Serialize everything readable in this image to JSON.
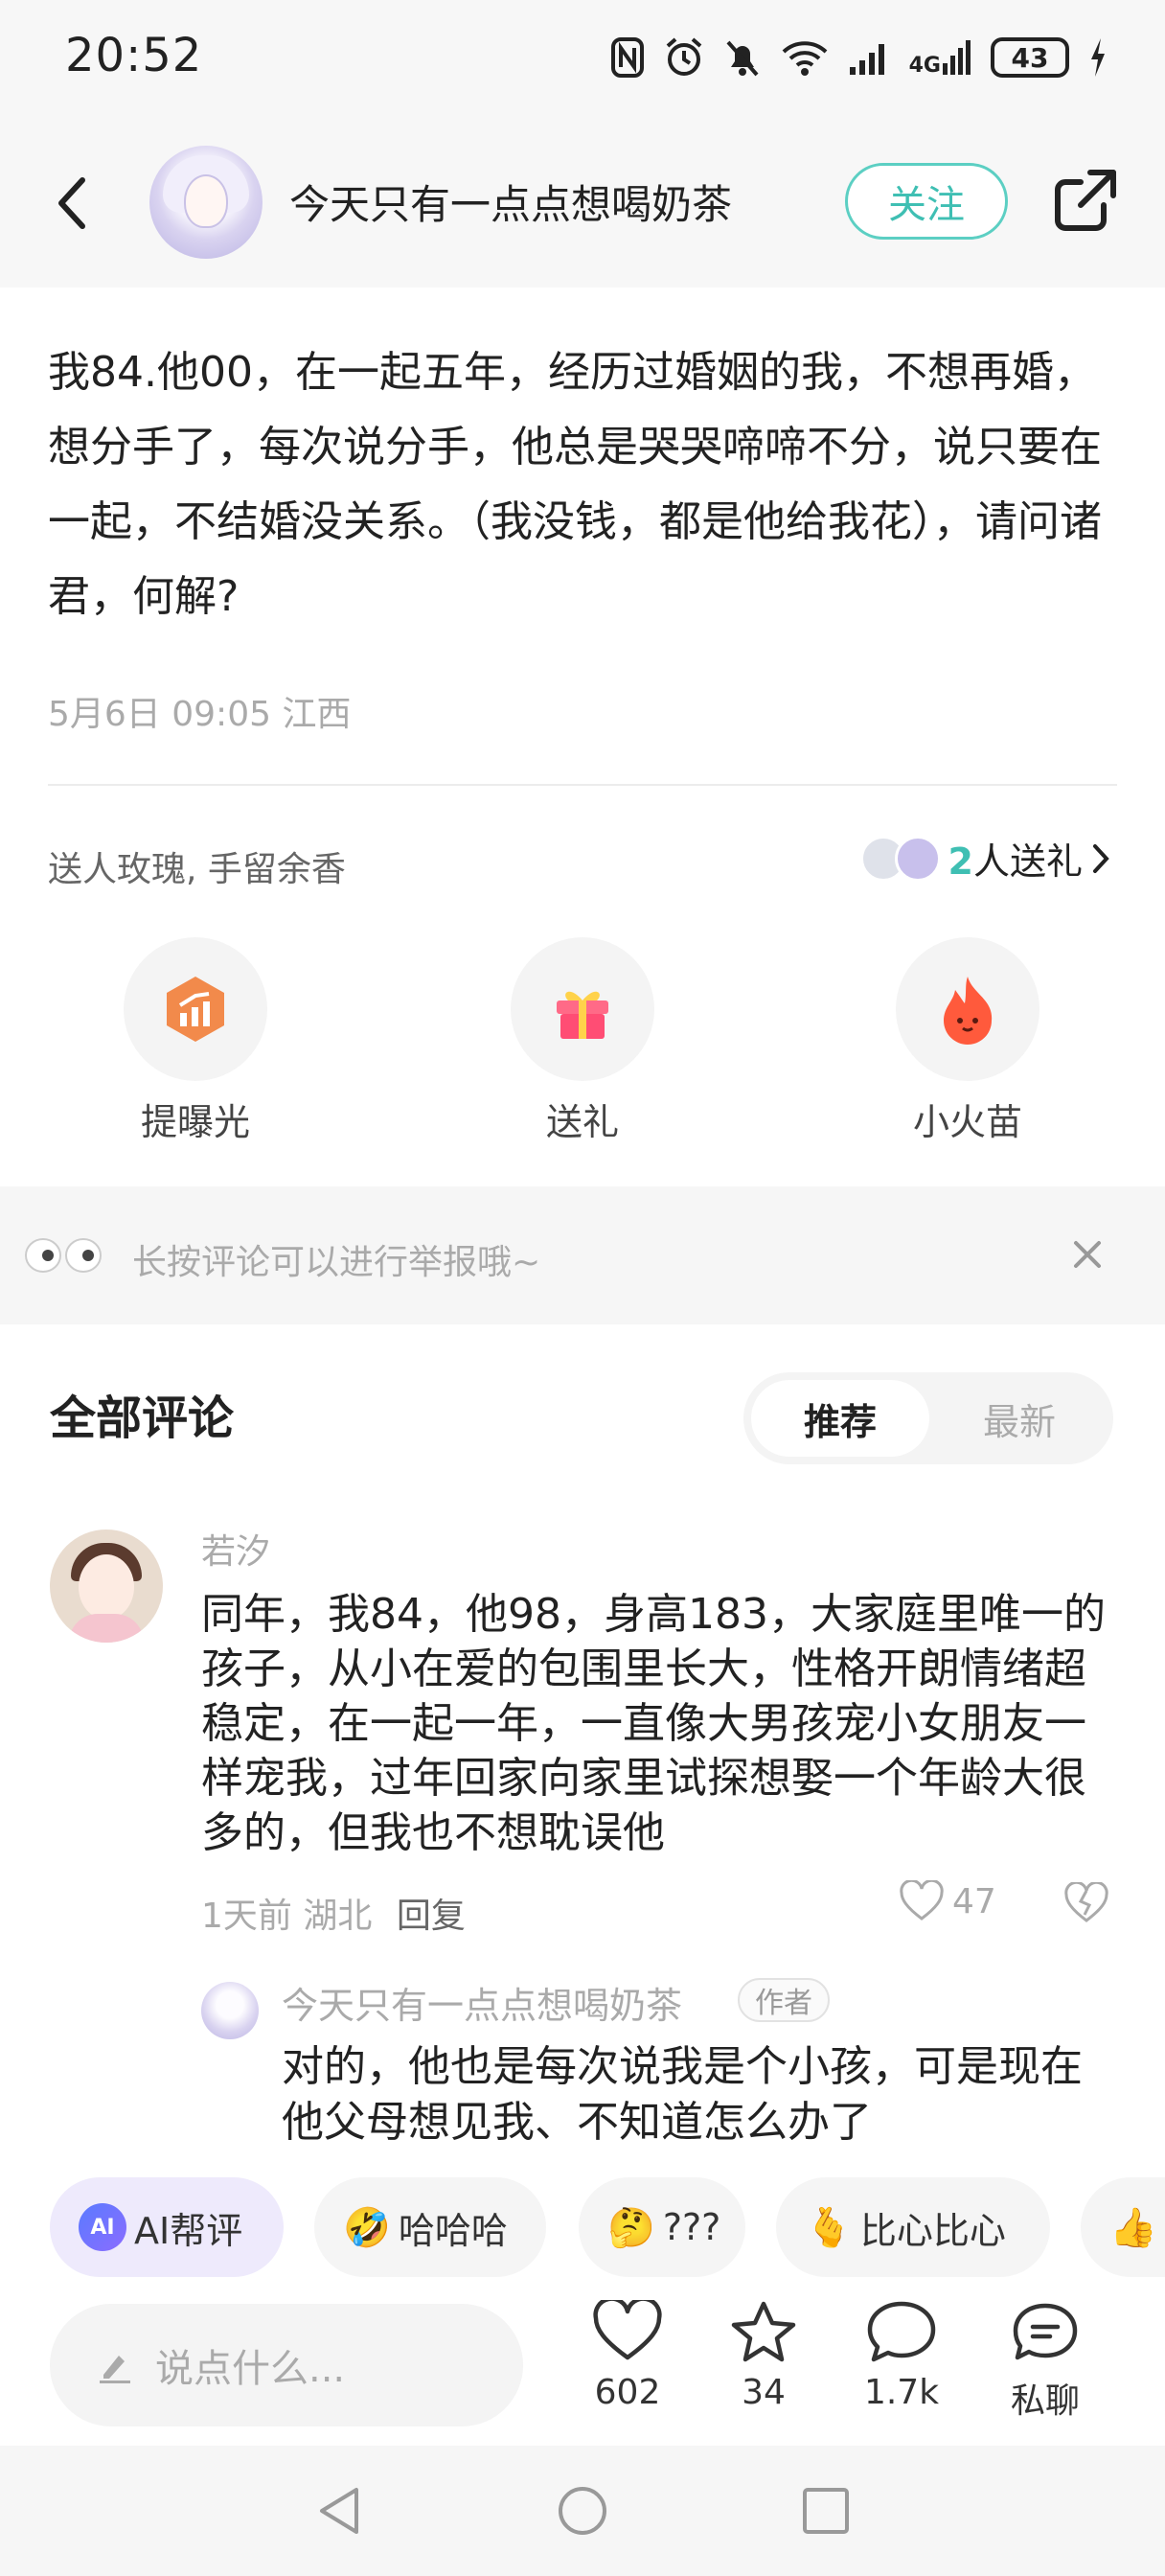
{
  "status_bar": {
    "time": "20:52",
    "network": "4G",
    "battery": "43",
    "icons": [
      "nfc-icon",
      "alarm-icon",
      "mute-icon",
      "wifi-icon",
      "signal-icon",
      "signal-4g-icon",
      "battery-icon",
      "charging-icon"
    ]
  },
  "header": {
    "title": "今天只有一点点想喝奶茶",
    "follow_label": "关注"
  },
  "post": {
    "text": "我84.他00，在一起五年，经历过婚姻的我，不想再婚，想分手了，每次说分手，他总是哭哭啼啼不分，说只要在一起，不结婚没关系。（我没钱，都是他给我花），请问诸君，何解?",
    "meta": "5月6日 09:05 江西"
  },
  "gifts": {
    "slogan": "送人玫瑰, 手留余香",
    "count": "2",
    "count_suffix": "人送礼"
  },
  "actions": [
    {
      "label": "提曝光",
      "icon": "boost-exposure-icon"
    },
    {
      "label": "送礼",
      "icon": "gift-icon"
    },
    {
      "label": "小火苗",
      "icon": "flame-icon"
    }
  ],
  "report_tip": "长按评论可以进行举报哦~",
  "comments_section": {
    "title": "全部评论",
    "tabs": [
      "推荐",
      "最新"
    ],
    "active_tab": "推荐"
  },
  "comment": {
    "author": "若汐",
    "text": "同年，我84，他98，身高183，大家庭里唯一的孩子，从小在爱的包围里长大，性格开朗情绪超稳定，在一起一年，一直像大男孩宠小女朋友一样宠我，过年回家向家里试探想娶一个年龄大很多的，但我也不想耽误他",
    "time": "1天前",
    "location": "湖北",
    "reply_label": "回复",
    "likes": "47"
  },
  "reply": {
    "author": "今天只有一点点想喝奶茶",
    "badge": "作者",
    "text": "对的，他也是每次说我是个小孩，可是现在他父母想见我、不知道怎么办了"
  },
  "quick_replies": [
    {
      "label": "AI帮评"
    },
    {
      "label": "哈哈哈",
      "emoji": "🤣"
    },
    {
      "label": "???",
      "emoji": "🤔"
    },
    {
      "label": "比心比心",
      "emoji": "🫰"
    },
    {
      "label": "",
      "emoji": "👍"
    }
  ],
  "bottom_bar": {
    "placeholder": "说点什么...",
    "likes": "602",
    "stars": "34",
    "comments": "1.7k",
    "dm_label": "私聊"
  },
  "colors": {
    "accent": "#3fbfb3",
    "text": "#222222",
    "muted": "#aaaaaa"
  }
}
